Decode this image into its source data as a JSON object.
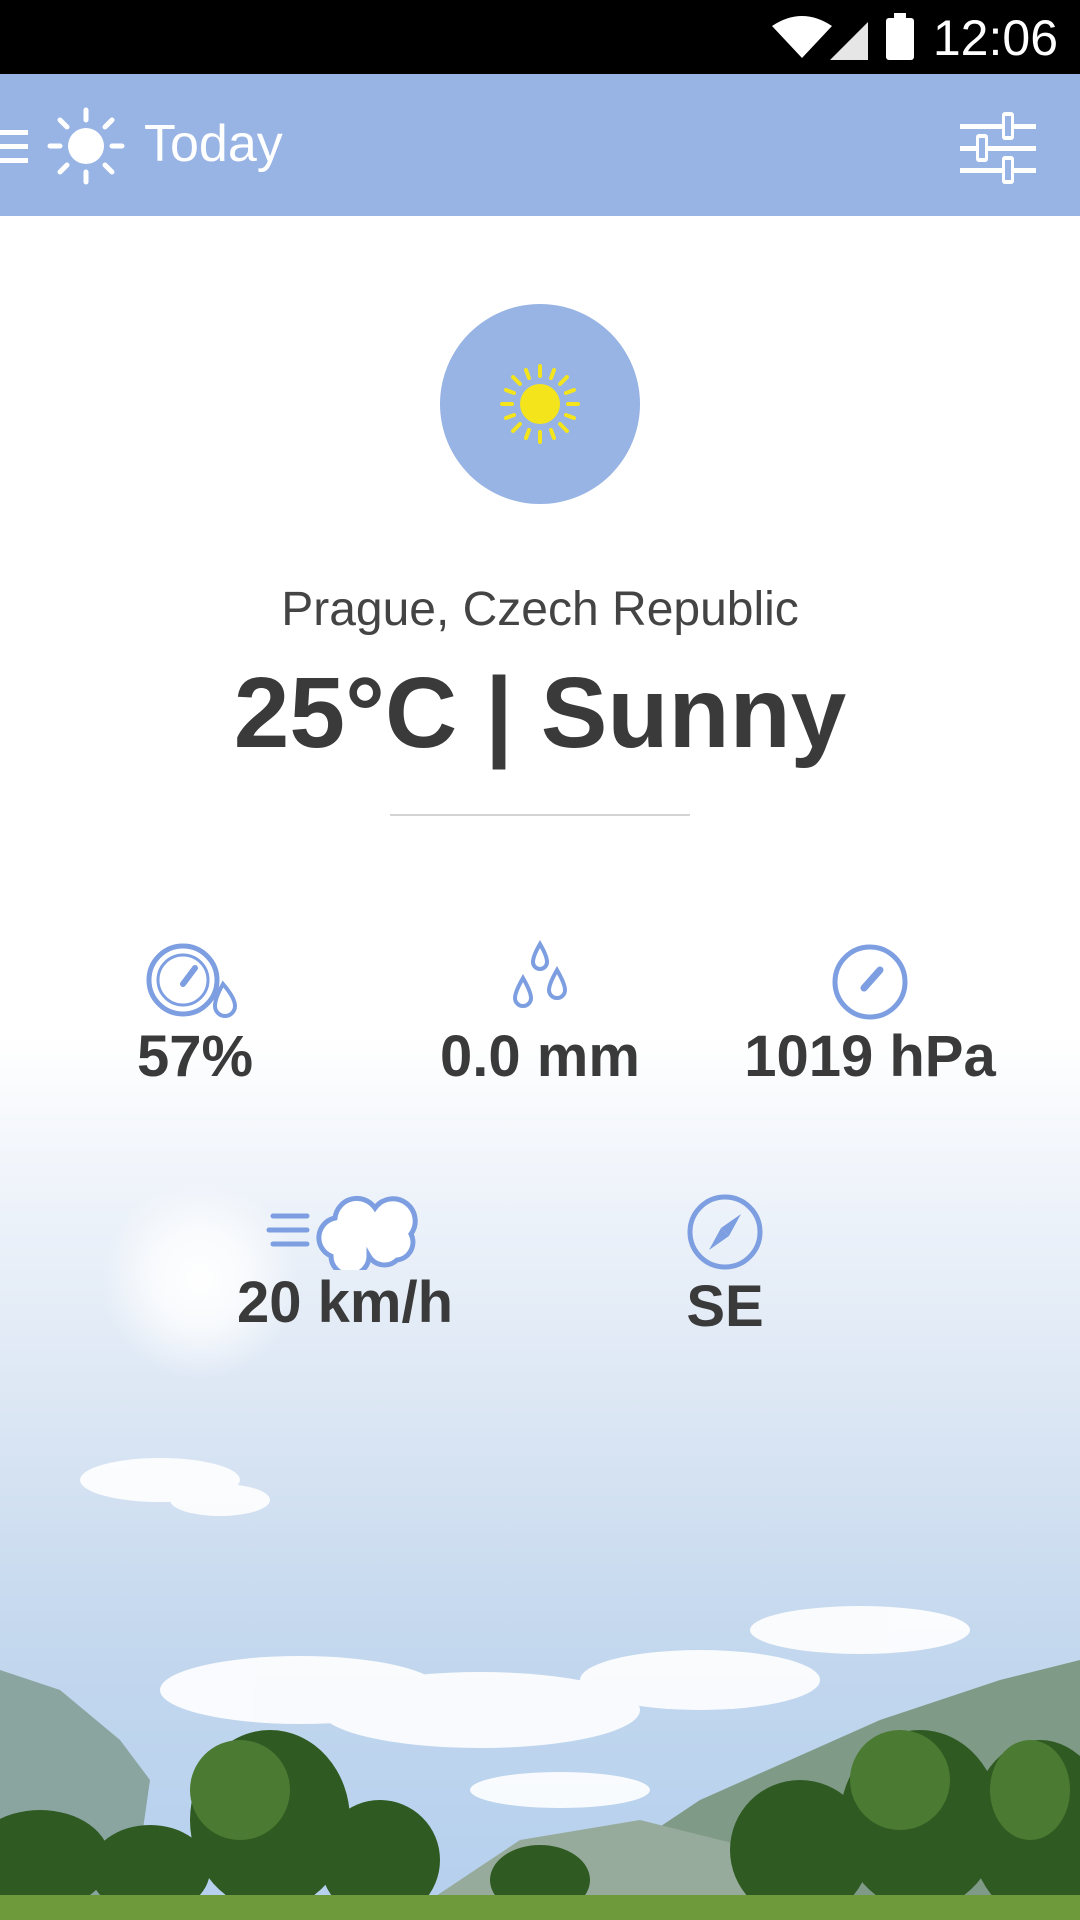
{
  "status_bar": {
    "time": "12:06"
  },
  "app_bar": {
    "title": "Today"
  },
  "current": {
    "location": "Prague, Czech Republic",
    "headline": "25°C | Sunny"
  },
  "stats": {
    "humidity": "57%",
    "precipitation": "0.0 mm",
    "pressure": "1019 hPa",
    "wind_speed": "20 km/h",
    "wind_direction": "SE"
  },
  "colors": {
    "accent": "#98b4e4",
    "icon_blue": "#7d9ee0",
    "sun_yellow": "#f4e41c",
    "text_dark": "#3a3a3a"
  }
}
